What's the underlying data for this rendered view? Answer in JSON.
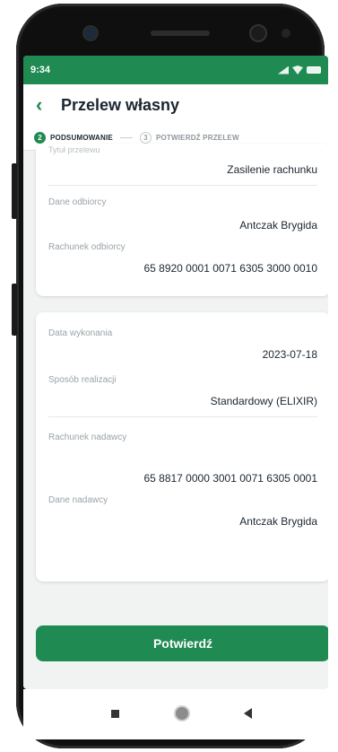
{
  "status_bar": {
    "time": "9:34"
  },
  "header": {
    "title": "Przelew własny"
  },
  "stepper": {
    "steps": [
      {
        "number": "2",
        "label": "PODSUMOWANIE"
      },
      {
        "number": "3",
        "label": "POTWIERDŹ PRZELEW"
      }
    ]
  },
  "card1": {
    "cut_label": "Tytuł przelewu",
    "title_value": "Zasilenie rachunku",
    "recipient_label": "Dane odbiorcy",
    "recipient_value": "Antczak Brygida",
    "recipient_account_label": "Rachunek odbiorcy",
    "recipient_account_value": "65 8920 0001 0071 6305 3000 0010"
  },
  "card2": {
    "date_label": "Data wykonania",
    "date_value": "2023-07-18",
    "mode_label": "Sposób realizacji",
    "mode_value": "Standardowy (ELIXIR)",
    "sender_account_label": "Rachunek nadawcy",
    "sender_account_value": "65 8817 0000 3001 0071 6305 0001",
    "sender_label": "Dane nadawcy",
    "sender_value": "Antczak Brygida"
  },
  "actions": {
    "confirm_label": "Potwierdź"
  },
  "icons": {
    "back": "chevron-left-icon",
    "nav_recent": "square-icon",
    "nav_home": "circle-icon",
    "nav_back": "triangle-back-icon"
  },
  "colors": {
    "accent": "#1f8a52",
    "background": "#f1f2f2",
    "card": "#ffffff"
  }
}
